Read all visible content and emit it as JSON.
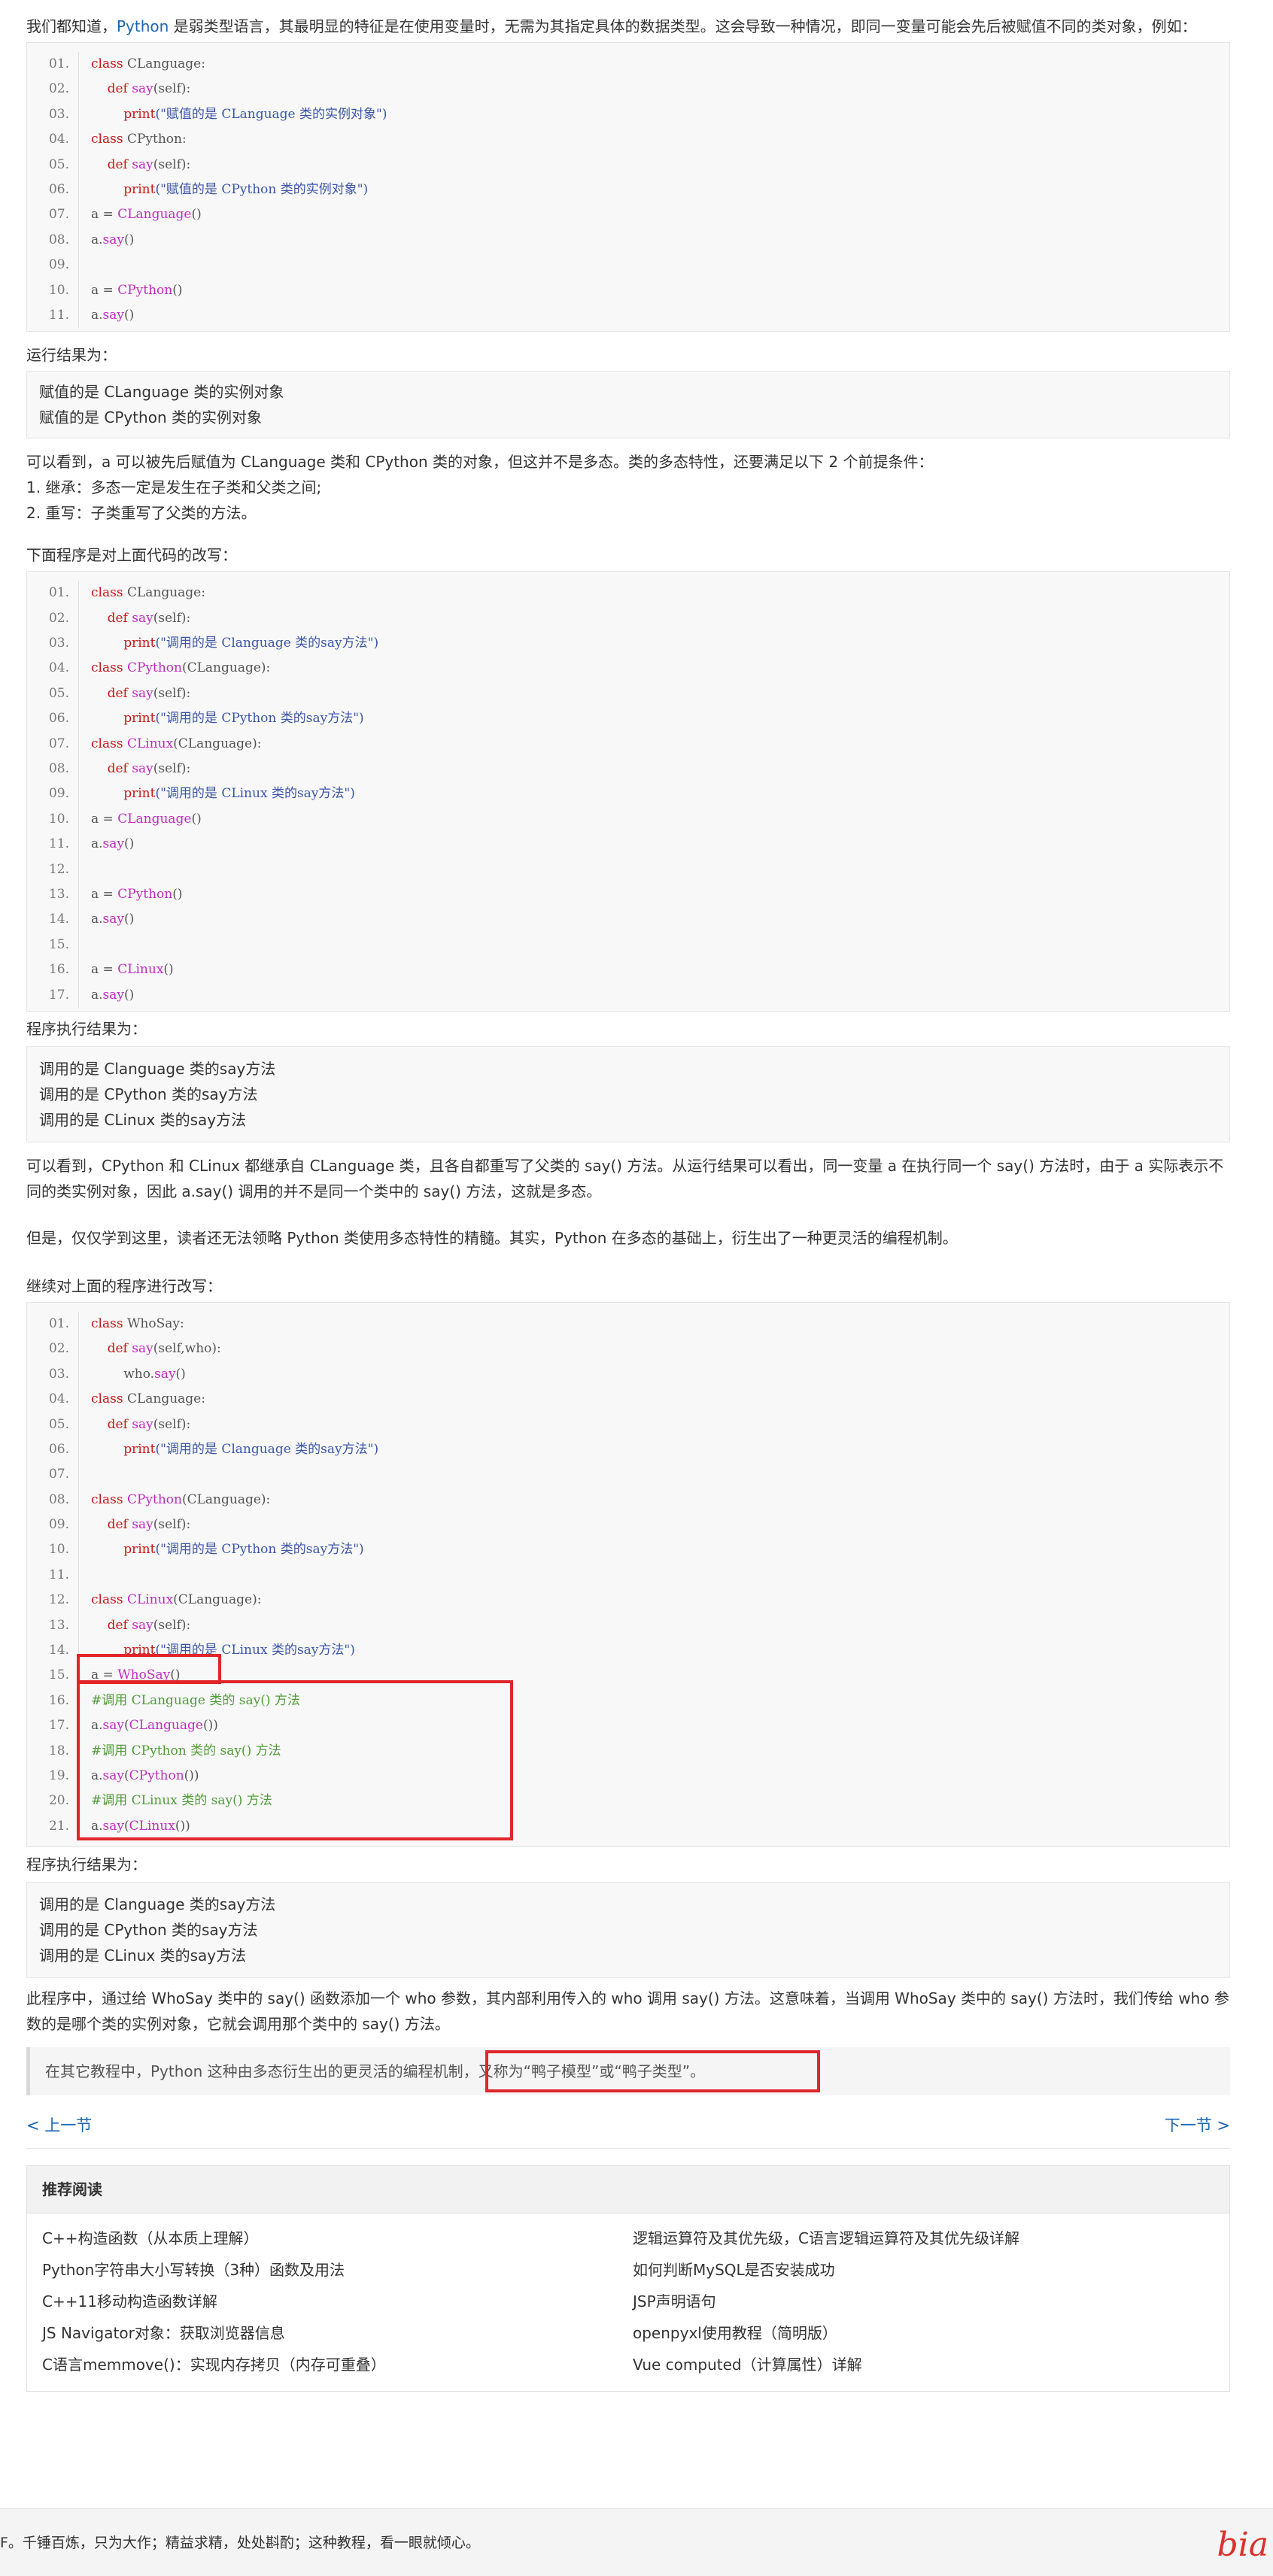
{
  "intro": {
    "before": "我们都知道，",
    "link": "Python",
    "after": " 是弱类型语言，其最明显的特征是在使用变量时，无需为其指定具体的数据类型。这会导致一种情况，即同一变量可能会先后被赋值不同的类对象，例如："
  },
  "code1": [
    [
      [
        "01.",
        "ln"
      ],
      [
        "class",
        "kw"
      ],
      [
        " CLanguage:",
        "pl"
      ]
    ],
    [
      [
        "02.",
        "ln"
      ],
      [
        "    def",
        "kw"
      ],
      [
        " say",
        "fn"
      ],
      [
        "(self):",
        "pl"
      ]
    ],
    [
      [
        "03.",
        "ln"
      ],
      [
        "        print",
        "kw"
      ],
      [
        "(\"赋值的是 CLanguage 类的实例对象\")",
        "str"
      ]
    ],
    [
      [
        "04.",
        "ln"
      ],
      [
        "class",
        "kw"
      ],
      [
        " CPython:",
        "pl"
      ]
    ],
    [
      [
        "05.",
        "ln"
      ],
      [
        "    def",
        "kw"
      ],
      [
        " say",
        "fn"
      ],
      [
        "(self):",
        "pl"
      ]
    ],
    [
      [
        "06.",
        "ln"
      ],
      [
        "        print",
        "kw"
      ],
      [
        "(\"赋值的是 CPython 类的实例对象\")",
        "str"
      ]
    ],
    [
      [
        "07.",
        "ln"
      ],
      [
        "a = ",
        "pl"
      ],
      [
        "CLanguage",
        "fn"
      ],
      [
        "()",
        "pl"
      ]
    ],
    [
      [
        "08.",
        "ln"
      ],
      [
        "a.",
        "pl"
      ],
      [
        "say",
        "fn"
      ],
      [
        "()",
        "pl"
      ]
    ],
    [
      [
        "09.",
        "ln"
      ]
    ],
    [
      [
        "10.",
        "ln"
      ],
      [
        "a = ",
        "pl"
      ],
      [
        "CPython",
        "fn"
      ],
      [
        "()",
        "pl"
      ]
    ],
    [
      [
        "11.",
        "ln"
      ],
      [
        "a.",
        "pl"
      ],
      [
        "say",
        "fn"
      ],
      [
        "()",
        "pl"
      ]
    ]
  ],
  "label1": "运行结果为：",
  "out1": [
    "赋值的是 CLanguage 类的实例对象",
    "赋值的是 CPython 类的实例对象"
  ],
  "para2": [
    "可以看到，a 可以被先后赋值为 CLanguage 类和 CPython 类的对象，但这并不是多态。类的多态特性，还要满足以下 2 个前提条件：",
    "1. 继承：多态一定是发生在子类和父类之间;",
    "2. 重写：子类重写了父类的方法。"
  ],
  "label2": "下面程序是对上面代码的改写：",
  "code2": [
    [
      [
        "01.",
        "ln"
      ],
      [
        "class",
        "kw"
      ],
      [
        " CLanguage:",
        "pl"
      ]
    ],
    [
      [
        "02.",
        "ln"
      ],
      [
        "    def",
        "kw"
      ],
      [
        " say",
        "fn"
      ],
      [
        "(self):",
        "pl"
      ]
    ],
    [
      [
        "03.",
        "ln"
      ],
      [
        "        print",
        "kw"
      ],
      [
        "(\"调用的是 Clanguage 类的say方法\")",
        "str"
      ]
    ],
    [
      [
        "04.",
        "ln"
      ],
      [
        "class",
        "kw"
      ],
      [
        " CPython",
        "fn"
      ],
      [
        "(CLanguage):",
        "pl"
      ]
    ],
    [
      [
        "05.",
        "ln"
      ],
      [
        "    def",
        "kw"
      ],
      [
        " say",
        "fn"
      ],
      [
        "(self):",
        "pl"
      ]
    ],
    [
      [
        "06.",
        "ln"
      ],
      [
        "        print",
        "kw"
      ],
      [
        "(\"调用的是 CPython 类的say方法\")",
        "str"
      ]
    ],
    [
      [
        "07.",
        "ln"
      ],
      [
        "class",
        "kw"
      ],
      [
        " CLinux",
        "fn"
      ],
      [
        "(CLanguage):",
        "pl"
      ]
    ],
    [
      [
        "08.",
        "ln"
      ],
      [
        "    def",
        "kw"
      ],
      [
        " say",
        "fn"
      ],
      [
        "(self):",
        "pl"
      ]
    ],
    [
      [
        "09.",
        "ln"
      ],
      [
        "        print",
        "kw"
      ],
      [
        "(\"调用的是 CLinux 类的say方法\")",
        "str"
      ]
    ],
    [
      [
        "10.",
        "ln"
      ],
      [
        "a = ",
        "pl"
      ],
      [
        "CLanguage",
        "fn"
      ],
      [
        "()",
        "pl"
      ]
    ],
    [
      [
        "11.",
        "ln"
      ],
      [
        "a.",
        "pl"
      ],
      [
        "say",
        "fn"
      ],
      [
        "()",
        "pl"
      ]
    ],
    [
      [
        "12.",
        "ln"
      ]
    ],
    [
      [
        "13.",
        "ln"
      ],
      [
        "a = ",
        "pl"
      ],
      [
        "CPython",
        "fn"
      ],
      [
        "()",
        "pl"
      ]
    ],
    [
      [
        "14.",
        "ln"
      ],
      [
        "a.",
        "pl"
      ],
      [
        "say",
        "fn"
      ],
      [
        "()",
        "pl"
      ]
    ],
    [
      [
        "15.",
        "ln"
      ]
    ],
    [
      [
        "16.",
        "ln"
      ],
      [
        "a = ",
        "pl"
      ],
      [
        "CLinux",
        "fn"
      ],
      [
        "()",
        "pl"
      ]
    ],
    [
      [
        "17.",
        "ln"
      ],
      [
        "a.",
        "pl"
      ],
      [
        "say",
        "fn"
      ],
      [
        "()",
        "pl"
      ]
    ]
  ],
  "label3": "程序执行结果为：",
  "out2": [
    "调用的是 Clanguage 类的say方法",
    "调用的是 CPython 类的say方法",
    "调用的是 CLinux 类的say方法"
  ],
  "para3": [
    "可以看到，CPython 和 CLinux 都继承自 CLanguage 类，且各自都重写了父类的 say() 方法。从运行结果可以看出，同一变量 a 在执行同一个 say() 方法时，由于 a 实际表示不同的类实例对象，因此 a.say() 调用的并不是同一个类中的 say() 方法，这就是多态。"
  ],
  "para4": "但是，仅仅学到这里，读者还无法领略 Python 类使用多态特性的精髓。其实，Python 在多态的基础上，衍生出了一种更灵活的编程机制。",
  "label4": "继续对上面的程序进行改写：",
  "code3": [
    [
      [
        "01.",
        "ln"
      ],
      [
        "class",
        "kw"
      ],
      [
        " WhoSay:",
        "pl"
      ]
    ],
    [
      [
        "02.",
        "ln"
      ],
      [
        "    def",
        "kw"
      ],
      [
        " say",
        "fn"
      ],
      [
        "(self,who):",
        "pl"
      ]
    ],
    [
      [
        "03.",
        "ln"
      ],
      [
        "        who.",
        "pl"
      ],
      [
        "say",
        "fn"
      ],
      [
        "()",
        "pl"
      ]
    ],
    [
      [
        "04.",
        "ln"
      ],
      [
        "class",
        "kw"
      ],
      [
        " CLanguage:",
        "pl"
      ]
    ],
    [
      [
        "05.",
        "ln"
      ],
      [
        "    def",
        "kw"
      ],
      [
        " say",
        "fn"
      ],
      [
        "(self):",
        "pl"
      ]
    ],
    [
      [
        "06.",
        "ln"
      ],
      [
        "        print",
        "kw"
      ],
      [
        "(\"调用的是 Clanguage 类的say方法\")",
        "str"
      ]
    ],
    [
      [
        "07.",
        "ln"
      ]
    ],
    [
      [
        "08.",
        "ln"
      ],
      [
        "class",
        "kw"
      ],
      [
        " CPython",
        "fn"
      ],
      [
        "(CLanguage):",
        "pl"
      ]
    ],
    [
      [
        "09.",
        "ln"
      ],
      [
        "    def",
        "kw"
      ],
      [
        " say",
        "fn"
      ],
      [
        "(self):",
        "pl"
      ]
    ],
    [
      [
        "10.",
        "ln"
      ],
      [
        "        print",
        "kw"
      ],
      [
        "(\"调用的是 CPython 类的say方法\")",
        "str"
      ]
    ],
    [
      [
        "11.",
        "ln"
      ]
    ],
    [
      [
        "12.",
        "ln"
      ],
      [
        "class",
        "kw"
      ],
      [
        " CLinux",
        "fn"
      ],
      [
        "(CLanguage):",
        "pl"
      ]
    ],
    [
      [
        "13.",
        "ln"
      ],
      [
        "    def",
        "kw"
      ],
      [
        " say",
        "fn"
      ],
      [
        "(self):",
        "pl"
      ]
    ],
    [
      [
        "14.",
        "ln"
      ],
      [
        "        print",
        "kw"
      ],
      [
        "(\"调用的是 CLinux 类的say方法\")",
        "str"
      ]
    ],
    [
      [
        "15.",
        "ln"
      ],
      [
        "a = ",
        "pl"
      ],
      [
        "WhoSay",
        "fn"
      ],
      [
        "()",
        "pl"
      ]
    ],
    [
      [
        "16.",
        "ln"
      ],
      [
        "#调用 CLanguage 类的 say() 方法",
        "cm"
      ]
    ],
    [
      [
        "17.",
        "ln"
      ],
      [
        "a.",
        "pl"
      ],
      [
        "say",
        "fn"
      ],
      [
        "(",
        "pl"
      ],
      [
        "CLanguage",
        "fn"
      ],
      [
        "())",
        "pl"
      ]
    ],
    [
      [
        "18.",
        "ln"
      ],
      [
        "#调用 CPython 类的 say() 方法",
        "cm"
      ]
    ],
    [
      [
        "19.",
        "ln"
      ],
      [
        "a.",
        "pl"
      ],
      [
        "say",
        "fn"
      ],
      [
        "(",
        "pl"
      ],
      [
        "CPython",
        "fn"
      ],
      [
        "())",
        "pl"
      ]
    ],
    [
      [
        "20.",
        "ln"
      ],
      [
        "#调用 CLinux 类的 say() 方法",
        "cm"
      ]
    ],
    [
      [
        "21.",
        "ln"
      ],
      [
        "a.",
        "pl"
      ],
      [
        "say",
        "fn"
      ],
      [
        "(",
        "pl"
      ],
      [
        "CLinux",
        "fn"
      ],
      [
        "())",
        "pl"
      ]
    ]
  ],
  "label5": "程序执行结果为：",
  "out3": [
    "调用的是 Clanguage 类的say方法",
    "调用的是 CPython 类的say方法",
    "调用的是 CLinux 类的say方法"
  ],
  "para5": "此程序中，通过给 WhoSay 类中的 say() 函数添加一个 who 参数，其内部利用传入的 who 调用 say() 方法。这意味着，当调用 WhoSay 类中的 say() 方法时，我们传给 who 参数的是哪个类的实例对象，它就会调用那个类中的 say() 方法。",
  "quote": "在其它教程中，Python 这种由多态衍生出的更灵活的编程机制，又称为“鸭子模型”或“鸭子类型”。",
  "nav": {
    "prev": "< 上一节",
    "next": "下一节 >"
  },
  "recommend": {
    "title": "推荐阅读",
    "items": [
      "C++构造函数（从本质上理解）",
      "逻辑运算符及其优先级，C语言逻辑运算符及其优先级详解",
      "Python字符串大小写转换（3种）函数及用法",
      "如何判断MySQL是否安装成功",
      "C++11移动构造函数详解",
      "JSP声明语句",
      "JS Navigator对象：获取浏览器信息",
      "openpyxl使用教程（简明版）",
      "C语言memmove()：实现内存拷贝（内存可重叠）",
      "Vue computed（计算属性）详解"
    ]
  },
  "footer": {
    "text": "F。千锤百炼，只为大作；精益求精，处处斟酌；这种教程，看一眼就倾心。",
    "logo": "bia"
  }
}
